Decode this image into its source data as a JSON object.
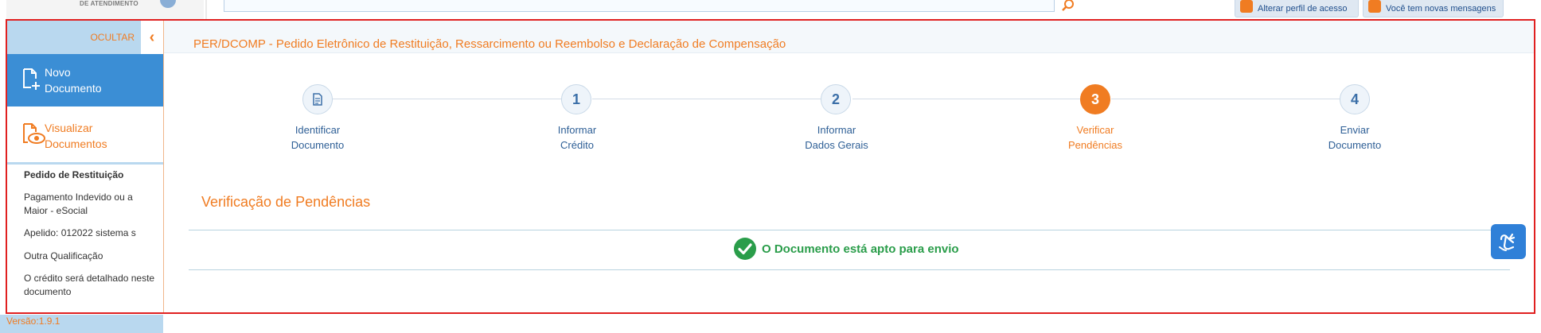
{
  "header": {
    "logo_text": "DE ATENDIMENTO",
    "search_placeholder": "",
    "buttons": {
      "alterar_perfil": "Alterar perfil de acesso",
      "mensagens": "Você tem novas mensagens"
    }
  },
  "sidebar": {
    "ocultar": "OCULTAR",
    "novo_line1": "Novo",
    "novo_line2": "Documento",
    "visualizar_line1": "Visualizar",
    "visualizar_line2": "Documentos",
    "doc_info": [
      "Pedido de Restituição",
      "Pagamento Indevido ou a Maior - eSocial",
      "Apelido: 012022 sistema s",
      "Outra Qualificação",
      "O crédito será detalhado neste documento"
    ],
    "versao": "Versão:1.9.1"
  },
  "main": {
    "title": "PER/DCOMP - Pedido Eletrônico de Restituição, Ressarcimento ou Reembolso e Declaração de Compensação",
    "steps": [
      {
        "number": "",
        "icon": "document-icon",
        "line1": "Identificar",
        "line2": "Documento",
        "state": "done"
      },
      {
        "number": "1",
        "line1": "Informar",
        "line2": "Crédito",
        "state": "pending"
      },
      {
        "number": "2",
        "line1": "Informar",
        "line2": "Dados Gerais",
        "state": "pending"
      },
      {
        "number": "3",
        "line1": "Verificar",
        "line2": "Pendências",
        "state": "active"
      },
      {
        "number": "4",
        "line1": "Enviar",
        "line2": "Documento",
        "state": "pending"
      }
    ],
    "section_title": "Verificação de Pendências",
    "status_message": "O Documento está apto para envio"
  },
  "colors": {
    "accent_orange": "#f07c22",
    "primary_blue": "#3b8ed5",
    "light_blue": "#b9d8ef",
    "success_green": "#2a9d4a",
    "frame_red": "#e02020"
  }
}
